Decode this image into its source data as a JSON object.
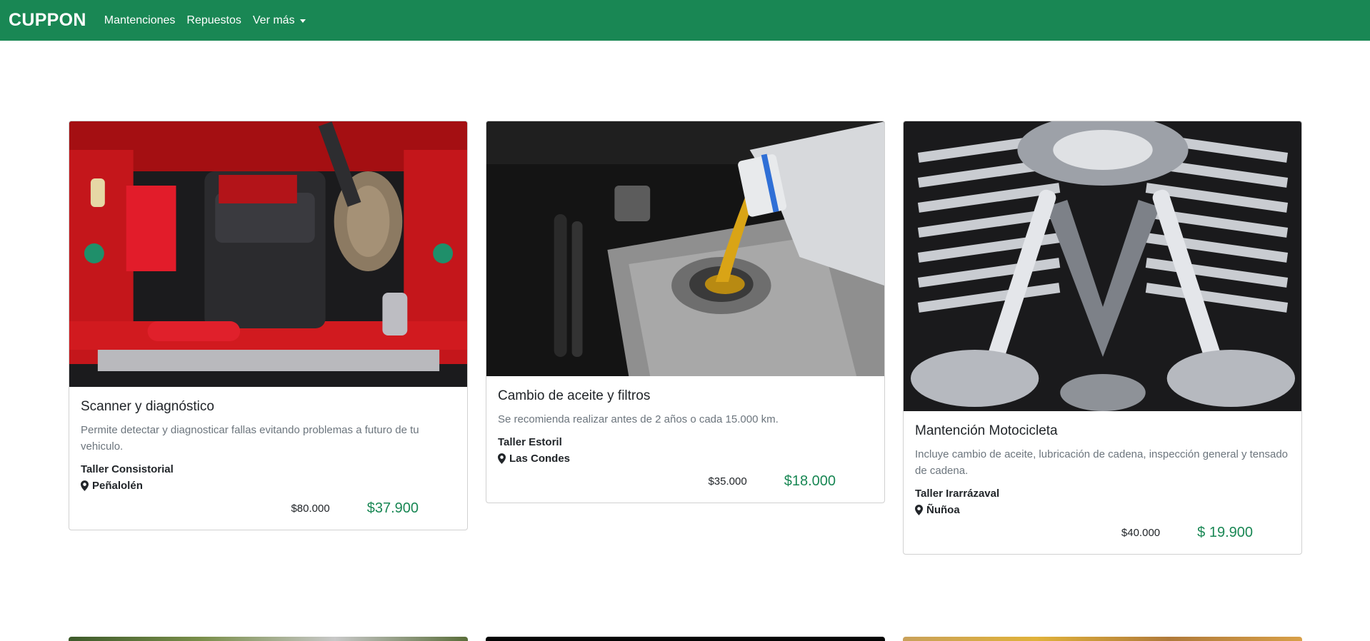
{
  "navbar": {
    "brand": "CUPPON",
    "links": [
      {
        "label": "Mantenciones"
      },
      {
        "label": "Repuestos"
      },
      {
        "label": "Ver más",
        "dropdown": true
      }
    ],
    "color": "#198754"
  },
  "cards": [
    {
      "title": "Scanner y diagnóstico",
      "description": "Permite detectar y diagnosticar fallas evitando problemas a futuro de tu vehiculo.",
      "shop": "Taller Consistorial",
      "location": "Peñalolén",
      "old_price": "$80.000",
      "new_price": "$37.900",
      "image": "red-car-engine-bay"
    },
    {
      "title": "Cambio de aceite y filtros",
      "description": "Se recomienda realizar antes de 2 años o cada 15.000 km.",
      "shop": "Taller Estoril",
      "location": "Las Condes",
      "old_price": "$35.000",
      "new_price": "$18.000",
      "image": "oil-pouring-into-engine"
    },
    {
      "title": "Mantención Motocicleta",
      "description": "Incluye cambio de aceite, lubricación de cadena, inspección general y tensado de cadena.",
      "shop": "Taller Irarrázaval",
      "location": "Ñuñoa",
      "old_price": "$40.000",
      "new_price": "$ 19.900",
      "image": "chrome-motorcycle-engine"
    }
  ],
  "colors": {
    "accent": "#198754",
    "muted_text": "#6c757d"
  }
}
